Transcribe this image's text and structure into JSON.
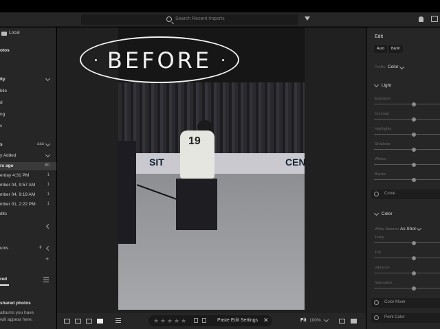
{
  "search": {
    "placeholder": "Search Recent Imports"
  },
  "left": {
    "local": "Local",
    "photos": "otos",
    "section1": "ity",
    "items1": [
      "bile",
      "d",
      "ng",
      "s"
    ],
    "section2": "s",
    "section2_extra": "aaa",
    "selected_top": "y Added",
    "recent": {
      "label": "rs ago",
      "count": "80"
    },
    "dates": [
      {
        "label": "erday 4:31 PM",
        "count": "1"
      },
      {
        "label": "mber 04, 9:57 AM",
        "count": "1"
      },
      {
        "label": "mber 04, 9:19 AM",
        "count": "1"
      },
      {
        "label": "mber 01, 2:22 PM",
        "count": "1"
      }
    ],
    "edits": "dits",
    "albums": "ums",
    "shared_tab": "red",
    "shared_title": "shared photos",
    "shared_body": [
      " albums you have",
      "will appear here."
    ]
  },
  "overlay": {
    "before": "BEFORE"
  },
  "photo": {
    "jersey_number": "19",
    "board_text_1": "SIT",
    "board_text_2": "CEN"
  },
  "bottom": {
    "stars": [
      "★",
      "★",
      "★",
      "★",
      "★"
    ],
    "paste_label": "Paste Edit Settings",
    "close": "✕",
    "fit": "Fit",
    "zoom": "100%"
  },
  "right": {
    "edit_title": "Edit",
    "auto": "Auto",
    "bw": "B&W",
    "profile_label": "Profile",
    "profile_value": "Color",
    "light_title": "Light",
    "light_sliders": [
      "Exposure",
      "Contrast",
      "Highlights",
      "Shadows",
      "Whites",
      "Blacks"
    ],
    "light_slider_levels": [
      0.6,
      0.6,
      0.6,
      0.6,
      0.6,
      0.6
    ],
    "curve": "Curve",
    "color_title": "Color",
    "wb_label": "White Balance",
    "wb_value": "As Shot",
    "color_sliders": [
      "Temp",
      "Tint",
      "Vibrance",
      "Saturation"
    ],
    "color_slider_levels": [
      0.6,
      0.6,
      0.6,
      0.6
    ],
    "color_mixer": "Color Mixer",
    "point_color": "Point Color"
  }
}
